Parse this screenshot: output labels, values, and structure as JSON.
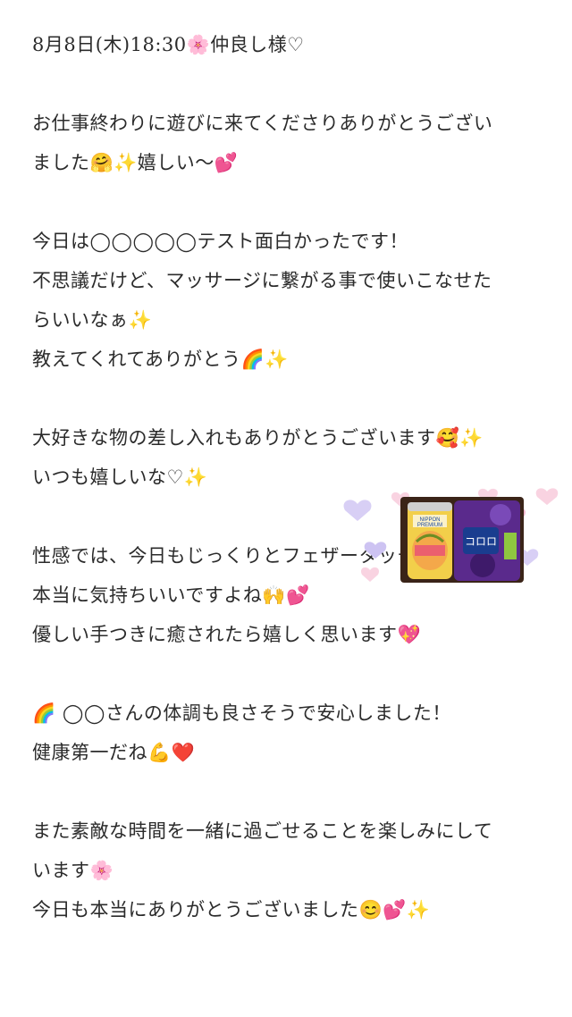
{
  "post": {
    "lines": [
      "8月8日(木)18:30🌸仲良し様♡",
      "",
      "お仕事終わりに遊びに来てくださりありがとうござい",
      "ました🤗✨嬉しい〜💕",
      "",
      "今日は◯◯◯◯◯テスト面白かったです！",
      "不思議だけど、マッサージに繋がる事で使いこなせた",
      "らいいなぁ✨",
      "教えてくれてありがとう🌈✨",
      "",
      "大好きな物の差し入れもありがとうございます🥰✨",
      "いつも嬉しいな♡✨",
      "",
      "性感では、今日もじっくりとフェザータッチ♡",
      "本当に気持ちいいですよね🙌💕",
      "優しい手つきに癒されたら嬉しく思います💖",
      "",
      "🌈 ◯◯さんの体調も良さそうで安心しました！",
      "健康第一だね💪❤️",
      "",
      "また素敵な時間を一緒に過ごせることを楽しみにして",
      "います🌸",
      "今日も本当にありがとうございました😊💕✨"
    ]
  },
  "photo": {
    "can_label_top": "NIPPON",
    "can_label_bottom": "PREMIUM",
    "gummy_label": "コロロ"
  },
  "colors": {
    "text": "#2b2b2b",
    "heart_pink": "#f7c6d8",
    "heart_purple": "#cdc3f2",
    "can_yellow": "#f2cf4a",
    "gummy_purple": "#5a2a8c"
  }
}
